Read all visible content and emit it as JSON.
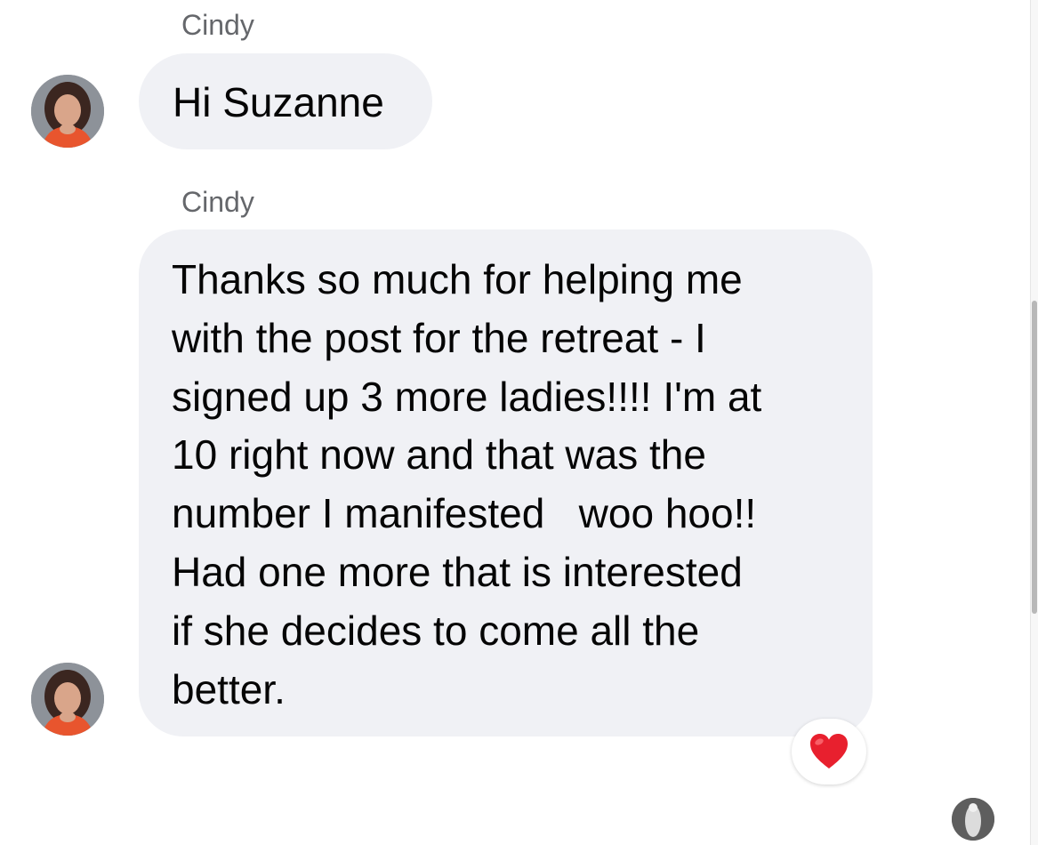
{
  "conversation": {
    "messages": [
      {
        "sender": "Cindy",
        "lines": [
          "Hi Suzanne"
        ]
      },
      {
        "sender": "Cindy",
        "lines": [
          "Thanks so much for helping me",
          "with the post for the retreat - I",
          "signed up 3 more ladies!!!! I'm at",
          "10 right now and that was the",
          "number I manifested   woo hoo!!",
          "Had one more that is interested",
          "if she decides to come all the",
          "better."
        ],
        "reaction": {
          "icon": "red-heart-icon",
          "glyph": "❤️",
          "color": "#e8202e"
        }
      }
    ]
  },
  "theme": {
    "bubble_color": "#f0f1f5",
    "sender_name_color": "#65676b",
    "text_color": "#050505"
  }
}
